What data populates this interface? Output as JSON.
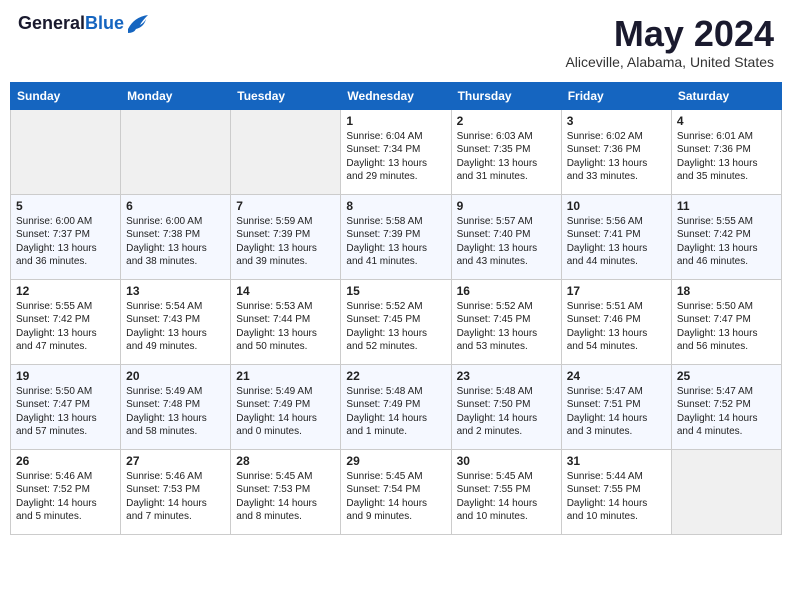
{
  "header": {
    "logo_general": "General",
    "logo_blue": "Blue",
    "month_title": "May 2024",
    "subtitle": "Aliceville, Alabama, United States"
  },
  "weekdays": [
    "Sunday",
    "Monday",
    "Tuesday",
    "Wednesday",
    "Thursday",
    "Friday",
    "Saturday"
  ],
  "weeks": [
    [
      {
        "day": "",
        "info": ""
      },
      {
        "day": "",
        "info": ""
      },
      {
        "day": "",
        "info": ""
      },
      {
        "day": "1",
        "info": "Sunrise: 6:04 AM\nSunset: 7:34 PM\nDaylight: 13 hours\nand 29 minutes."
      },
      {
        "day": "2",
        "info": "Sunrise: 6:03 AM\nSunset: 7:35 PM\nDaylight: 13 hours\nand 31 minutes."
      },
      {
        "day": "3",
        "info": "Sunrise: 6:02 AM\nSunset: 7:36 PM\nDaylight: 13 hours\nand 33 minutes."
      },
      {
        "day": "4",
        "info": "Sunrise: 6:01 AM\nSunset: 7:36 PM\nDaylight: 13 hours\nand 35 minutes."
      }
    ],
    [
      {
        "day": "5",
        "info": "Sunrise: 6:00 AM\nSunset: 7:37 PM\nDaylight: 13 hours\nand 36 minutes."
      },
      {
        "day": "6",
        "info": "Sunrise: 6:00 AM\nSunset: 7:38 PM\nDaylight: 13 hours\nand 38 minutes."
      },
      {
        "day": "7",
        "info": "Sunrise: 5:59 AM\nSunset: 7:39 PM\nDaylight: 13 hours\nand 39 minutes."
      },
      {
        "day": "8",
        "info": "Sunrise: 5:58 AM\nSunset: 7:39 PM\nDaylight: 13 hours\nand 41 minutes."
      },
      {
        "day": "9",
        "info": "Sunrise: 5:57 AM\nSunset: 7:40 PM\nDaylight: 13 hours\nand 43 minutes."
      },
      {
        "day": "10",
        "info": "Sunrise: 5:56 AM\nSunset: 7:41 PM\nDaylight: 13 hours\nand 44 minutes."
      },
      {
        "day": "11",
        "info": "Sunrise: 5:55 AM\nSunset: 7:42 PM\nDaylight: 13 hours\nand 46 minutes."
      }
    ],
    [
      {
        "day": "12",
        "info": "Sunrise: 5:55 AM\nSunset: 7:42 PM\nDaylight: 13 hours\nand 47 minutes."
      },
      {
        "day": "13",
        "info": "Sunrise: 5:54 AM\nSunset: 7:43 PM\nDaylight: 13 hours\nand 49 minutes."
      },
      {
        "day": "14",
        "info": "Sunrise: 5:53 AM\nSunset: 7:44 PM\nDaylight: 13 hours\nand 50 minutes."
      },
      {
        "day": "15",
        "info": "Sunrise: 5:52 AM\nSunset: 7:45 PM\nDaylight: 13 hours\nand 52 minutes."
      },
      {
        "day": "16",
        "info": "Sunrise: 5:52 AM\nSunset: 7:45 PM\nDaylight: 13 hours\nand 53 minutes."
      },
      {
        "day": "17",
        "info": "Sunrise: 5:51 AM\nSunset: 7:46 PM\nDaylight: 13 hours\nand 54 minutes."
      },
      {
        "day": "18",
        "info": "Sunrise: 5:50 AM\nSunset: 7:47 PM\nDaylight: 13 hours\nand 56 minutes."
      }
    ],
    [
      {
        "day": "19",
        "info": "Sunrise: 5:50 AM\nSunset: 7:47 PM\nDaylight: 13 hours\nand 57 minutes."
      },
      {
        "day": "20",
        "info": "Sunrise: 5:49 AM\nSunset: 7:48 PM\nDaylight: 13 hours\nand 58 minutes."
      },
      {
        "day": "21",
        "info": "Sunrise: 5:49 AM\nSunset: 7:49 PM\nDaylight: 14 hours\nand 0 minutes."
      },
      {
        "day": "22",
        "info": "Sunrise: 5:48 AM\nSunset: 7:49 PM\nDaylight: 14 hours\nand 1 minute."
      },
      {
        "day": "23",
        "info": "Sunrise: 5:48 AM\nSunset: 7:50 PM\nDaylight: 14 hours\nand 2 minutes."
      },
      {
        "day": "24",
        "info": "Sunrise: 5:47 AM\nSunset: 7:51 PM\nDaylight: 14 hours\nand 3 minutes."
      },
      {
        "day": "25",
        "info": "Sunrise: 5:47 AM\nSunset: 7:52 PM\nDaylight: 14 hours\nand 4 minutes."
      }
    ],
    [
      {
        "day": "26",
        "info": "Sunrise: 5:46 AM\nSunset: 7:52 PM\nDaylight: 14 hours\nand 5 minutes."
      },
      {
        "day": "27",
        "info": "Sunrise: 5:46 AM\nSunset: 7:53 PM\nDaylight: 14 hours\nand 7 minutes."
      },
      {
        "day": "28",
        "info": "Sunrise: 5:45 AM\nSunset: 7:53 PM\nDaylight: 14 hours\nand 8 minutes."
      },
      {
        "day": "29",
        "info": "Sunrise: 5:45 AM\nSunset: 7:54 PM\nDaylight: 14 hours\nand 9 minutes."
      },
      {
        "day": "30",
        "info": "Sunrise: 5:45 AM\nSunset: 7:55 PM\nDaylight: 14 hours\nand 10 minutes."
      },
      {
        "day": "31",
        "info": "Sunrise: 5:44 AM\nSunset: 7:55 PM\nDaylight: 14 hours\nand 10 minutes."
      },
      {
        "day": "",
        "info": ""
      }
    ]
  ]
}
